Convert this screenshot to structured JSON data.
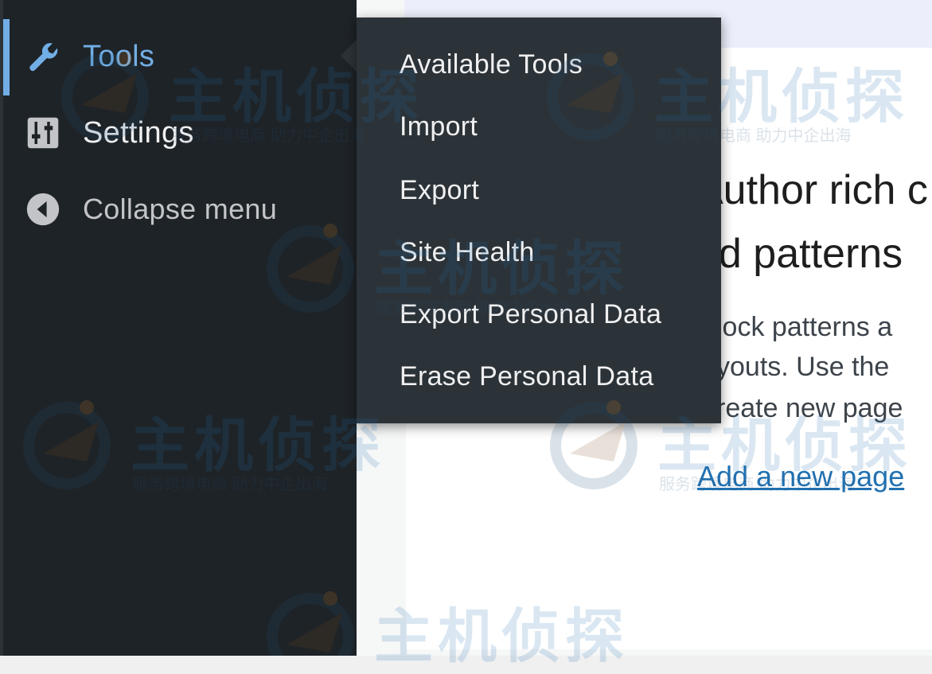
{
  "sidebar": {
    "items": [
      {
        "label": "Tools",
        "icon": "wrench-icon"
      },
      {
        "label": "Settings",
        "icon": "sliders-icon"
      },
      {
        "label": "Collapse menu",
        "icon": "collapse-arrow-icon"
      }
    ]
  },
  "flyout": {
    "items": [
      {
        "label": "Available Tools"
      },
      {
        "label": "Import"
      },
      {
        "label": "Export"
      },
      {
        "label": "Site Health"
      },
      {
        "label": "Export Personal Data"
      },
      {
        "label": "Erase Personal Data"
      }
    ]
  },
  "main": {
    "heading_line1": "Author rich c",
    "heading_line2": "nd patterns",
    "body_lines": [
      "lock patterns a",
      "youts. Use the",
      "reate new page"
    ],
    "link": "Add a new page"
  },
  "watermark": {
    "title": "主机侦探",
    "subtitle": "服务跨境电商 助力中企出海"
  },
  "colors": {
    "sidebar_bg": "#1e2327",
    "flyout_bg": "#2c3338",
    "accent": "#72aee6",
    "link": "#2271b1"
  }
}
